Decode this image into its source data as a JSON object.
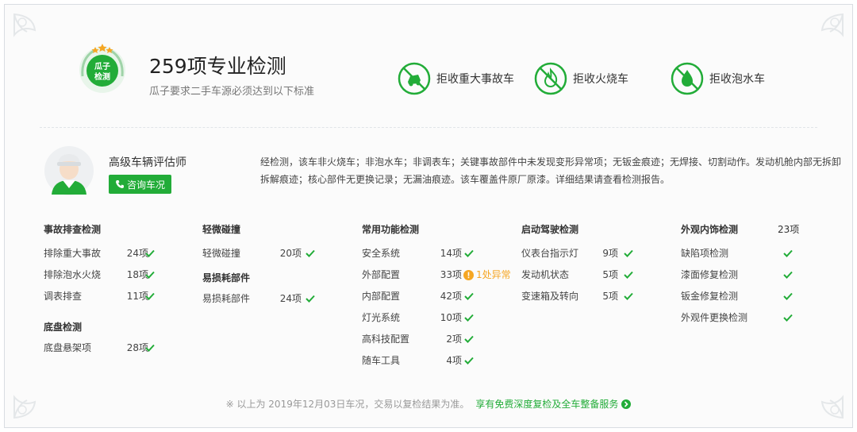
{
  "header": {
    "badge_text": "瓜子检测",
    "title": "259项专业检测",
    "subtitle": "瓜子要求二手车源必须达到以下标准"
  },
  "rejects": [
    {
      "label": "拒收重大事故车",
      "icon": "accident-car-icon"
    },
    {
      "label": "拒收火烧车",
      "icon": "fire-icon"
    },
    {
      "label": "拒收泡水车",
      "icon": "water-drop-icon"
    }
  ],
  "inspector": {
    "title": "高级车辆评估师",
    "button_label": "咨询车况",
    "summary": "经检测，该车非火烧车；非泡水车；非调表车；关键事故部件中未发现变形异常项；无钣金痕迹；无焊接、切割动作。发动机舱内部无拆卸拆解痕迹；核心部件无更换记录；无漏油痕迹。该车覆盖件原厂原漆。详细结果请查看检测报告。"
  },
  "columns": [
    {
      "groups": [
        {
          "title": "事故排查检测",
          "items": [
            {
              "name": "排除重大事故",
              "count": "24项"
            },
            {
              "name": "排除泡水火烧",
              "count": "18项"
            },
            {
              "name": "调表排查",
              "count": "11项"
            }
          ]
        },
        {
          "title": "底盘检测",
          "items": [
            {
              "name": "底盘悬架项",
              "count": "28项"
            }
          ]
        }
      ]
    },
    {
      "groups": [
        {
          "title": "轻微碰撞",
          "items": [
            {
              "name": "轻微碰撞",
              "count": "20项"
            }
          ]
        },
        {
          "title": "易损耗部件",
          "items": [
            {
              "name": "易损耗部件",
              "count": "24项"
            }
          ]
        }
      ]
    },
    {
      "groups": [
        {
          "title": "常用功能检测",
          "items": [
            {
              "name": "安全系统",
              "count": "14项"
            },
            {
              "name": "外部配置",
              "count": "33项",
              "warning": "1处异常"
            },
            {
              "name": "内部配置",
              "count": "42项"
            },
            {
              "name": "灯光系统",
              "count": "10项"
            },
            {
              "name": "高科技配置",
              "count": "2项"
            },
            {
              "name": "随车工具",
              "count": "4项"
            }
          ]
        }
      ]
    },
    {
      "groups": [
        {
          "title": "启动驾驶检测",
          "items": [
            {
              "name": "仪表台指示灯",
              "count": "9项"
            },
            {
              "name": "发动机状态",
              "count": "5项"
            },
            {
              "name": "变速箱及转向",
              "count": "5项"
            }
          ]
        }
      ]
    },
    {
      "groups": [
        {
          "title": "外观内饰检测",
          "title_count": "23项",
          "items": [
            {
              "name": "缺陷项检测",
              "count": ""
            },
            {
              "name": "漆面修复检测",
              "count": ""
            },
            {
              "name": "钣金修复检测",
              "count": ""
            },
            {
              "name": "外观件更换检测",
              "count": ""
            }
          ]
        }
      ]
    }
  ],
  "footer": {
    "note": "※ 以上为 2019年12月03日车况，交易以复检结果为准。",
    "link": "享有免费深度复检及全车整备服务"
  },
  "colors": {
    "accent": "#22ac38",
    "warning": "#f5a623",
    "text": "#333333",
    "muted": "#999999"
  }
}
